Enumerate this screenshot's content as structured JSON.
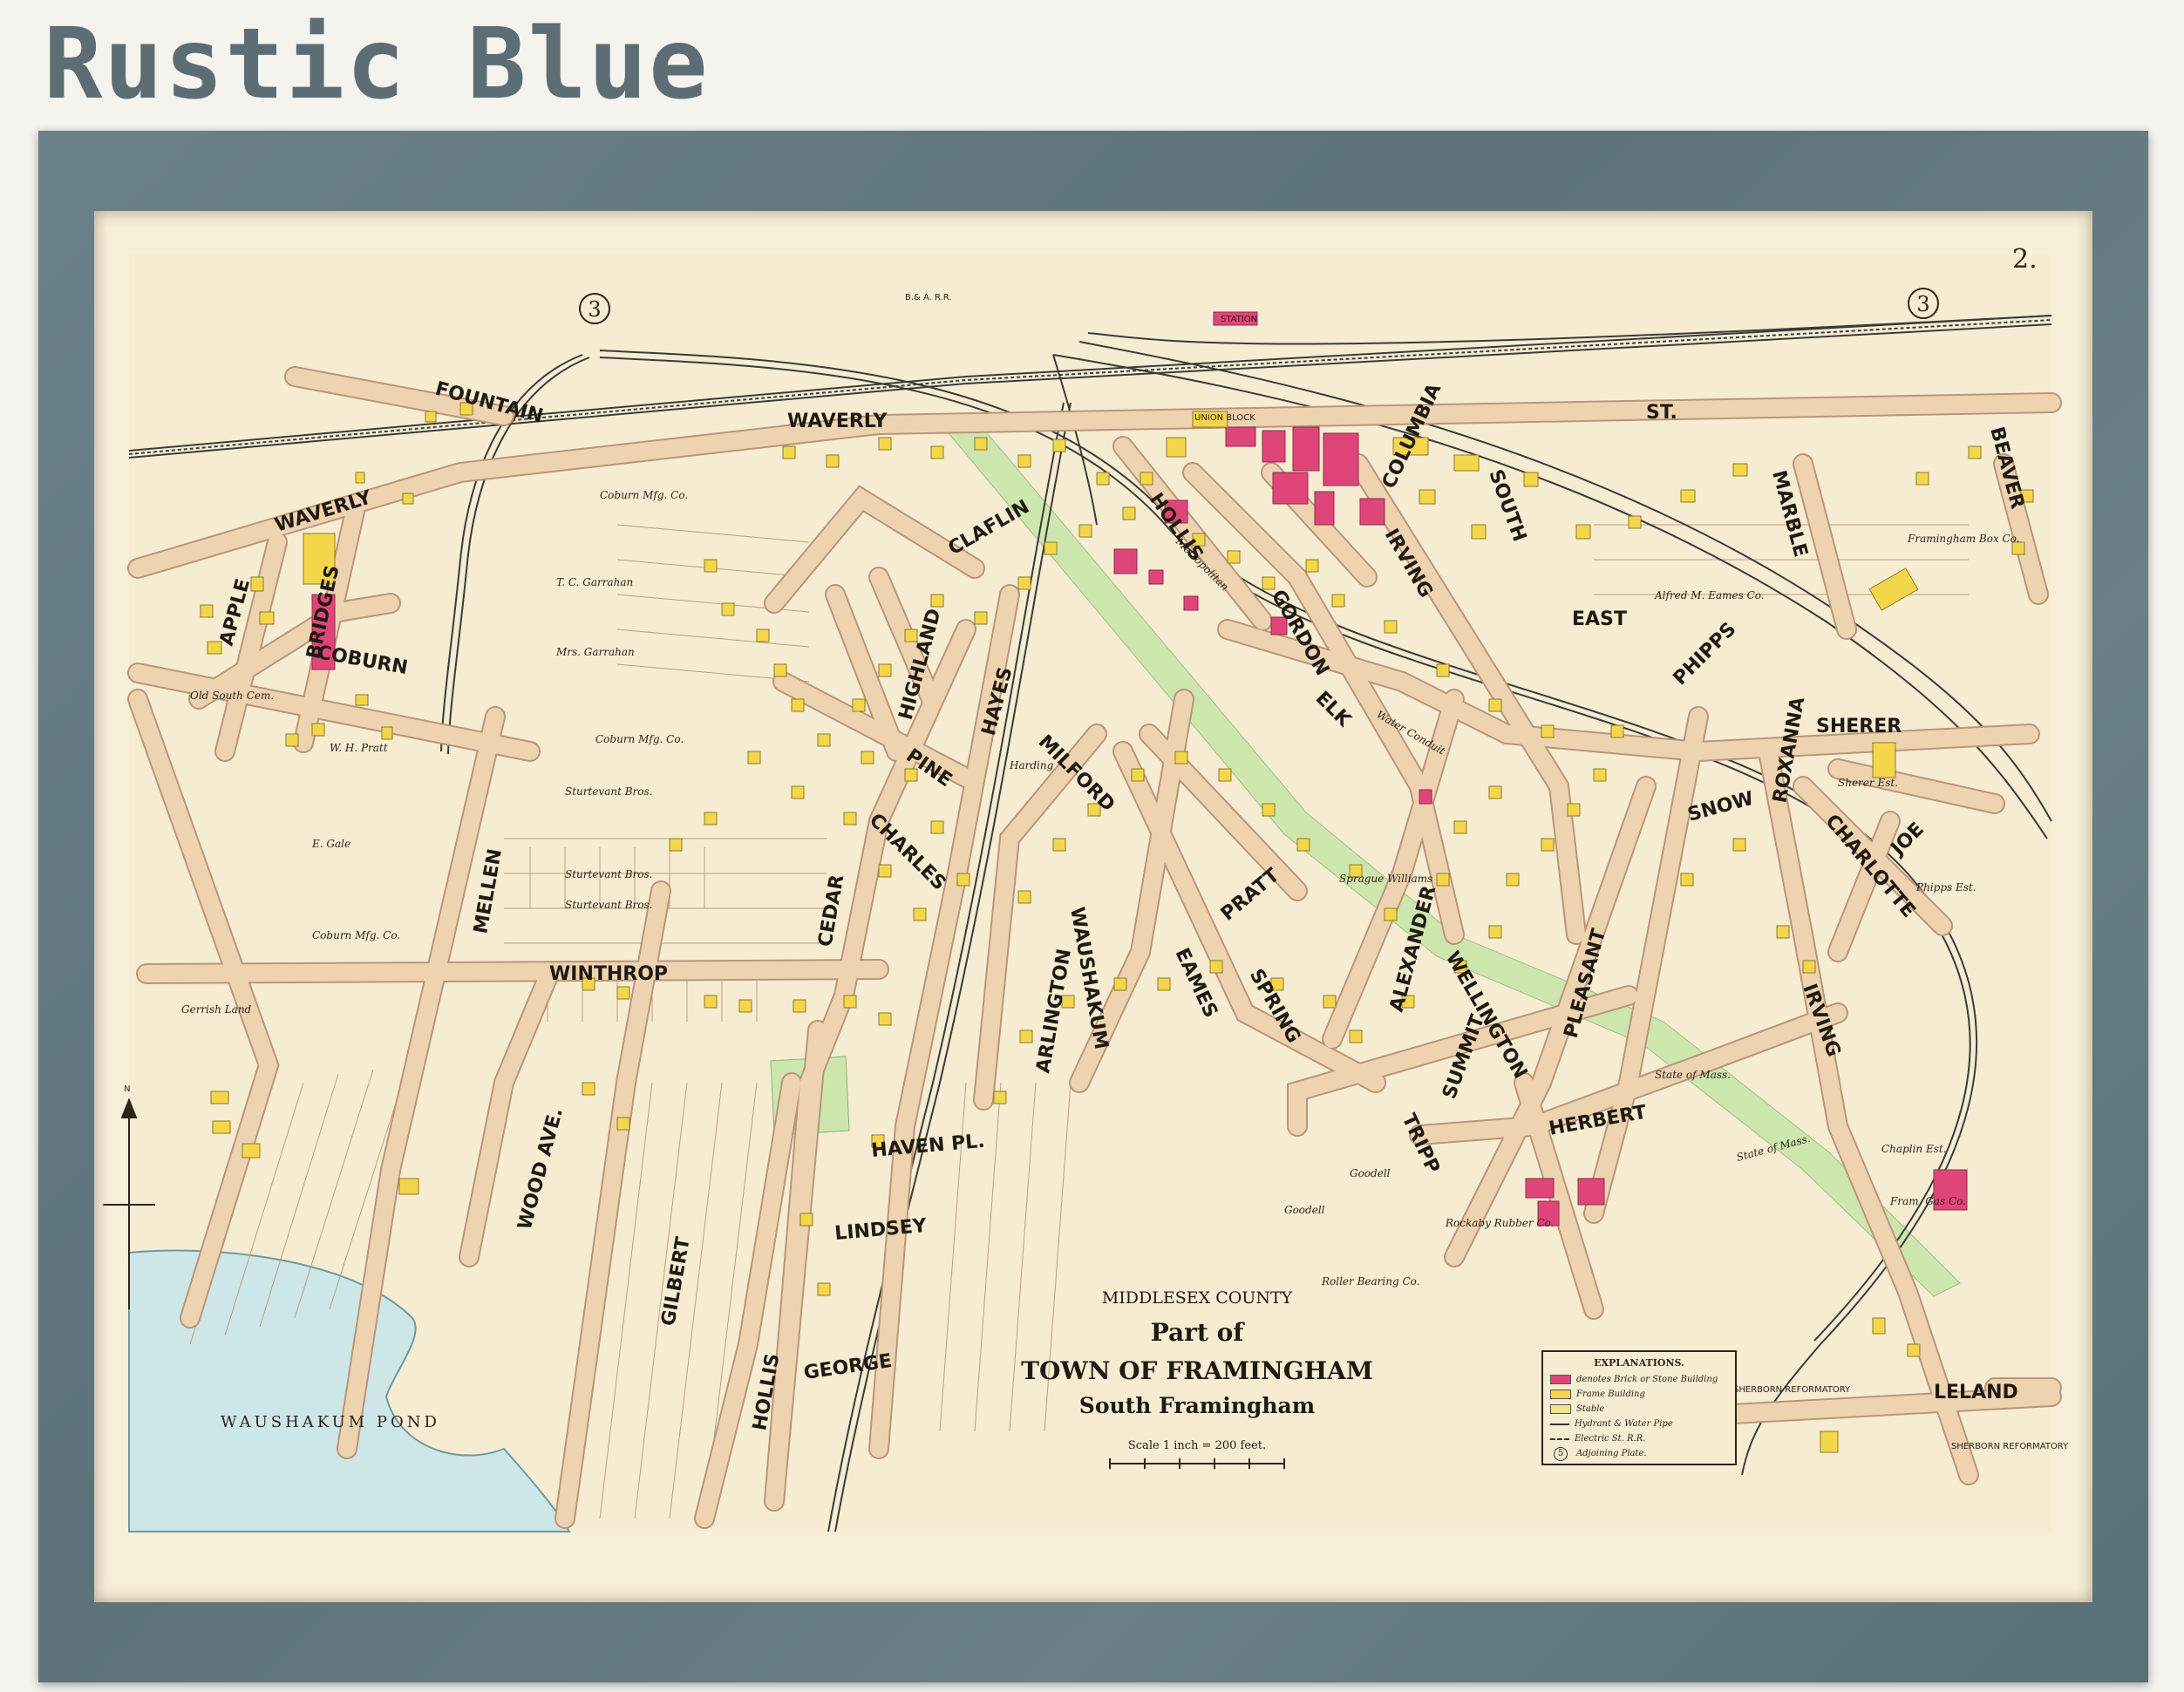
{
  "brand": {
    "title": "Rustic Blue"
  },
  "map": {
    "plate_number": "2.",
    "adjoining_plate": "3",
    "railroad_label": "B.& A. R.R.",
    "station_label": "STATION",
    "title": {
      "county": "MIDDLESEX COUNTY",
      "part_of": "Part of",
      "town": "TOWN OF FRAMINGHAM",
      "subtitle": "South Framingham",
      "scale": "Scale 1 inch = 200 feet."
    },
    "water": {
      "pond": "WAUSHAKUM POND"
    },
    "streets": {
      "waverly_top": "WAVERLY",
      "st_top": "ST.",
      "waverly_west": "WAVERLY",
      "fountain": "FOUNTAIN",
      "coburn": "COBURN",
      "apple": "APPLE",
      "bridges": "BRIDGES",
      "claflin": "CLAFLIN",
      "highland": "HIGHLAND",
      "hayes": "HAYES",
      "milford": "MILFORD",
      "pine": "PINE",
      "cedar": "CEDAR",
      "charles": "CHARLES",
      "mellen": "MELLEN",
      "winthrop": "WINTHROP",
      "wood_ave": "WOOD AVE.",
      "gilbert": "GILBERT",
      "hollis_south": "HOLLIS",
      "george": "GEORGE",
      "lindsey": "LINDSEY",
      "haven": "HAVEN PL.",
      "waushakum": "WAUSHAKUM",
      "arlington": "ARLINGTON",
      "eames": "EAMES",
      "pratt": "PRATT",
      "spring": "SPRING",
      "alexander": "ALEXANDER",
      "wellington": "WELLINGTON",
      "summit": "SUMMIT",
      "pleasant": "PLEASANT",
      "herbert": "HERBERT",
      "tripp": "TRIPP",
      "irving_south": "IRVING",
      "irving_north": "IRVING",
      "gordon": "GORDON",
      "hollis_north": "HOLLIS",
      "columbia": "COLUMBIA",
      "south": "SOUTH",
      "east": "EAST",
      "marble": "MARBLE",
      "beaver": "BEAVER",
      "phipps": "PHIPPS",
      "sherer": "SHERER",
      "snow": "SNOW",
      "roxanna": "ROXANNA",
      "charlotte": "CHARLOTTE",
      "joe": "JOE",
      "leland": "LELAND",
      "elk": "ELK",
      "st_suffix": "ST."
    },
    "owners": {
      "coburn_mfg_1": "Coburn Mfg. Co.",
      "coburn_mfg_2": "Coburn Mfg. Co.",
      "coburn_mfg_3": "Coburn Mfg. Co.",
      "garrahan_tc": "T. C. Garrahan",
      "garrahan_mrs": "Mrs. Garrahan",
      "pratt_wh": "W. H. Pratt",
      "gale_e": "E. Gale",
      "sturtevant_1": "Sturtevant Bros.",
      "sturtevant_2": "Sturtevant Bros.",
      "sturtevant_3": "Sturtevant Bros.",
      "gerrish": "Gerrish Land",
      "old_south": "Old South Cem.",
      "goodell_1": "Goodell",
      "goodell_2": "Goodell",
      "state_mass_1": "State of Mass.",
      "state_mass_2": "State of Mass.",
      "chaplin": "Chaplin Est.",
      "fram_gas": "Fram. Gas Co.",
      "rubber": "Rockaby Rubber Co.",
      "roller": "Roller Bearing Co.",
      "sherborn_1": "SHERBORN REFORMATORY",
      "sherborn_2": "SHERBORN REFORMATORY",
      "eames_alfred": "Alfred M. Eames Co.",
      "framingham_box": "Framingham Box Co.",
      "metropolitan": "Metropolitan",
      "water_conduit": "Water Conduit",
      "union_block": "UNION BLOCK",
      "sprague": "Sprague Williams",
      "sherer_est": "Sherer Est.",
      "phipps_est": "Phipps Est.",
      "harding": "Harding"
    },
    "legend": {
      "title": "EXPLANATIONS.",
      "items": [
        {
          "label": "denotes Brick or Stone Building",
          "color": "#e0457a",
          "symbol": "rect"
        },
        {
          "label": "Frame Building",
          "color": "#f3d64a",
          "symbol": "rect"
        },
        {
          "label": "Stable",
          "color": "#f3e48e",
          "symbol": "rect"
        },
        {
          "label": "Hydrant & Water Pipe",
          "color": "#333333",
          "symbol": "dot"
        },
        {
          "label": "Electric St. R.R.",
          "color": "#333333",
          "symbol": "dash"
        },
        {
          "label": "Adjoining Plate.",
          "color": "#333333",
          "symbol": "circle",
          "number": "5"
        }
      ]
    },
    "north_label": "N",
    "colors": {
      "paper": "#f7efd9",
      "street": "#eed3b1",
      "street_edge": "#b9957a",
      "brick": "#e0457a",
      "frame": "#f3d64a",
      "green": "#cde6ad",
      "water": "#cde6e8",
      "frame_moulding": "#627780"
    }
  }
}
